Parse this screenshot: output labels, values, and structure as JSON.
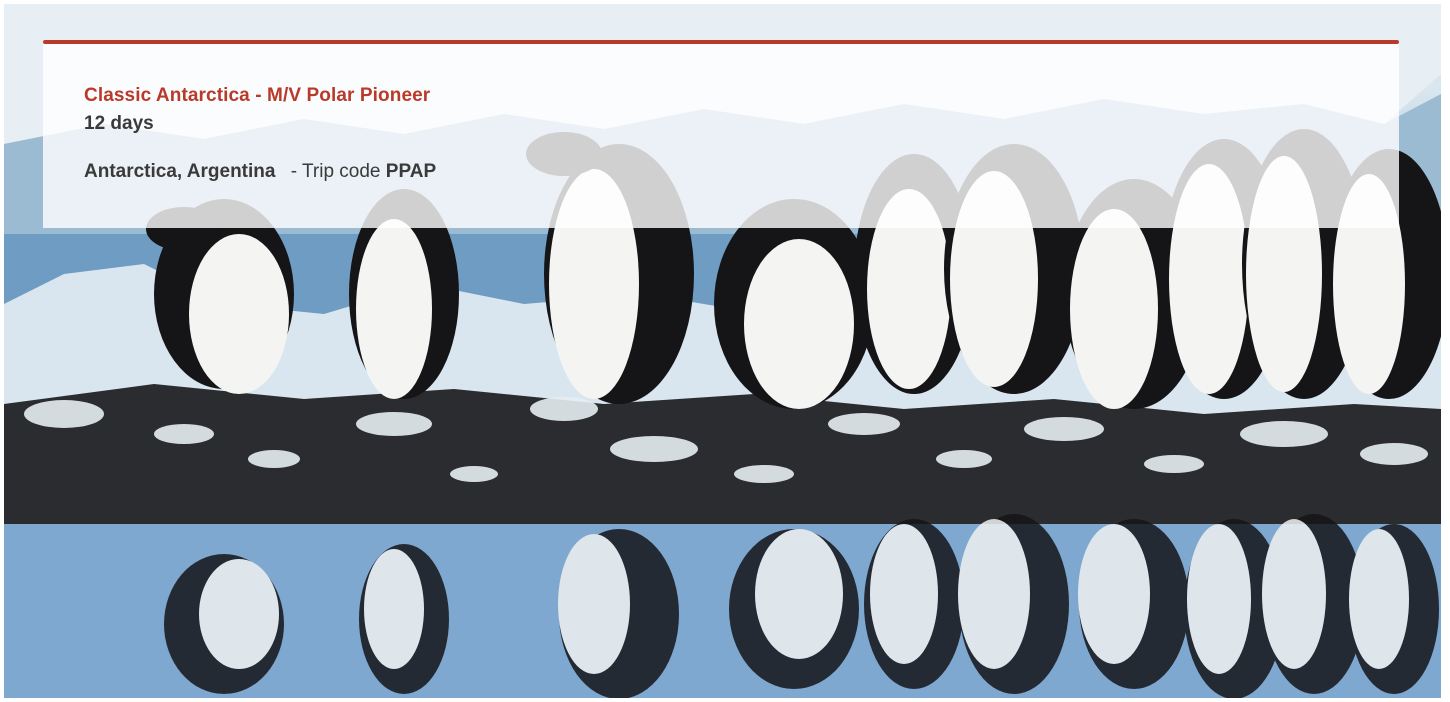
{
  "hero": {
    "image_icon": "penguin-photo",
    "colors": {
      "accent": "#b93a2a",
      "text": "#3a3a3a",
      "water": "#6f98c0",
      "ice": "#eef3f7"
    }
  },
  "trip": {
    "title": "Classic Antarctica - M/V Polar Pioneer",
    "duration": "12 days",
    "destinations": "Antarctica, Argentina",
    "separator": "- Trip code",
    "code": "PPAP"
  }
}
